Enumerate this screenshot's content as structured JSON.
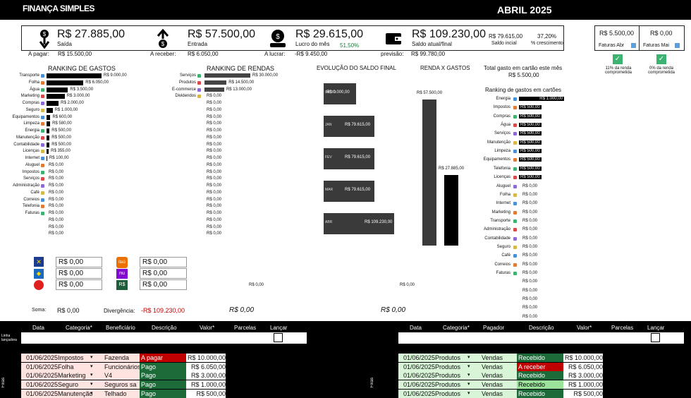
{
  "header": {
    "logo": "FINANÇA SIMPLES",
    "month": "ABRIL 2025"
  },
  "kpis": {
    "saida": {
      "value": "R$ 27.885,00",
      "label": "Saída"
    },
    "entrada": {
      "value": "R$ 57.500,00",
      "label": "Entrada"
    },
    "lucro": {
      "value": "R$ 29.615,00",
      "label": "Lucro do mês",
      "pct": "51,50%"
    },
    "saldo": {
      "value": "R$ 109.230,00",
      "label": "Saldo atual/final"
    },
    "saldo_inicial": {
      "value": "R$ 79.615,00",
      "label": "Saldo incial"
    },
    "crescimento": {
      "value": "37,20%",
      "label": "% crescimento"
    }
  },
  "subrow": {
    "a_pagar_label": "A pagar:",
    "a_pagar": "R$ 15.500,00",
    "a_receber_label": "A receber:",
    "a_receber": "R$ 6.050,00",
    "a_lucrar_label": "A lucrar:",
    "a_lucrar": "-R$ 9.450,00",
    "previsao_label": "previsão:",
    "previsao": "R$ 99.780,00"
  },
  "cards": {
    "abr": {
      "value": "R$ 5.500,00",
      "label": "Faturas Abr"
    },
    "mai": {
      "value": "R$ 0,00",
      "label": "Faturas Mai"
    },
    "pct_abr": "11% da renda comprometida",
    "pct_mai": "0% da renda comprometida"
  },
  "ranking_gastos": {
    "title": "RANKING DE GASTOS",
    "items": [
      {
        "label": "Transporte",
        "value": "R$ 9.000,00",
        "frac": 1.0
      },
      {
        "label": "Folha",
        "value": "R$ 6.050,00",
        "frac": 0.67
      },
      {
        "label": "Água",
        "value": "R$ 3.500,00",
        "frac": 0.39
      },
      {
        "label": "Marketing",
        "value": "R$ 3.000,00",
        "frac": 0.33
      },
      {
        "label": "Compras",
        "value": "R$ 2.000,00",
        "frac": 0.22
      },
      {
        "label": "Seguro",
        "value": "R$ 1.000,00",
        "frac": 0.11
      },
      {
        "label": "Equipamentos",
        "value": "R$ 600,00",
        "frac": 0.07
      },
      {
        "label": "Limpeza",
        "value": "R$ 580,00",
        "frac": 0.065
      },
      {
        "label": "Energia",
        "value": "R$ 500,00",
        "frac": 0.055
      },
      {
        "label": "Manutenção",
        "value": "R$ 500,00",
        "frac": 0.055
      },
      {
        "label": "Contabilidade",
        "value": "R$ 500,00",
        "frac": 0.055
      },
      {
        "label": "Licenças",
        "value": "R$ 355,00",
        "frac": 0.04
      },
      {
        "label": "Internet",
        "value": "R$ 100,00",
        "frac": 0.012
      },
      {
        "label": "Aluguel",
        "value": "R$ 0,00",
        "frac": 0
      },
      {
        "label": "Impostos",
        "value": "R$ 0,00",
        "frac": 0
      },
      {
        "label": "Serviços",
        "value": "R$ 0,00",
        "frac": 0
      },
      {
        "label": "Administração",
        "value": "R$ 0,00",
        "frac": 0
      },
      {
        "label": "Café",
        "value": "R$ 0,00",
        "frac": 0
      },
      {
        "label": "Correios",
        "value": "R$ 0,00",
        "frac": 0
      },
      {
        "label": "Telefonia",
        "value": "R$ 0,00",
        "frac": 0
      },
      {
        "label": "Faturas",
        "value": "R$ 0,00",
        "frac": 0
      },
      {
        "label": "",
        "value": "R$ 0,00",
        "frac": 0
      },
      {
        "label": "",
        "value": "R$ 0,00",
        "frac": 0
      },
      {
        "label": "",
        "value": "R$ 0,00",
        "frac": 0
      }
    ]
  },
  "ranking_rendas": {
    "title": "RANKING DE RENDAS",
    "items": [
      {
        "label": "Serviços",
        "value": "R$ 30.000,00",
        "frac": 1.0
      },
      {
        "label": "Produtos",
        "value": "R$ 14.500,00",
        "frac": 0.48
      },
      {
        "label": "E-commerce",
        "value": "R$ 13.000,00",
        "frac": 0.43
      },
      {
        "label": "Dividendos",
        "value": "R$ 0,00",
        "frac": 0
      },
      {
        "label": "",
        "value": "R$ 0,00",
        "frac": 0
      },
      {
        "label": "",
        "value": "R$ 0,00",
        "frac": 0
      },
      {
        "label": "",
        "value": "R$ 0,00",
        "frac": 0
      },
      {
        "label": "",
        "value": "R$ 0,00",
        "frac": 0
      },
      {
        "label": "",
        "value": "R$ 0,00",
        "frac": 0
      },
      {
        "label": "",
        "value": "R$ 0,00",
        "frac": 0
      },
      {
        "label": "",
        "value": "R$ 0,00",
        "frac": 0
      },
      {
        "label": "",
        "value": "R$ 0,00",
        "frac": 0
      },
      {
        "label": "",
        "value": "R$ 0,00",
        "frac": 0
      },
      {
        "label": "",
        "value": "R$ 0,00",
        "frac": 0
      },
      {
        "label": "",
        "value": "R$ 0,00",
        "frac": 0
      },
      {
        "label": "",
        "value": "R$ 0,00",
        "frac": 0
      },
      {
        "label": "",
        "value": "R$ 0,00",
        "frac": 0
      },
      {
        "label": "",
        "value": "R$ 0,00",
        "frac": 0
      },
      {
        "label": "",
        "value": "R$ 0,00",
        "frac": 0
      },
      {
        "label": "",
        "value": "R$ 0,00",
        "frac": 0
      },
      {
        "label": "",
        "value": "R$ 0,00",
        "frac": 0
      },
      {
        "label": "",
        "value": "R$ 0,00",
        "frac": 0
      },
      {
        "label": "",
        "value": "R$ 0,00",
        "frac": 0
      },
      {
        "label": "",
        "value": "R$ 0,00",
        "frac": 0
      }
    ]
  },
  "evolucao": {
    "title": "EVOLUÇÃO DO SALDO FINAL",
    "items": [
      {
        "label": "INÍCIO",
        "value": "R$ 0.000,00"
      },
      {
        "label": "JAN",
        "value": "R$ 79.615,00"
      },
      {
        "label": "FEV",
        "value": "R$ 79.615,00"
      },
      {
        "label": "MAR",
        "value": "R$ 79.615,00"
      },
      {
        "label": "ABR",
        "value": "R$ 109.230,00"
      }
    ],
    "footer": "R$ 0,00"
  },
  "renda_gastos": {
    "title": "RENDA X GASTOS",
    "renda": "R$ 57.500,00",
    "gastos": "R$ 27.885,00",
    "footer": "R$ 0,00"
  },
  "cartao": {
    "total_label": "Total gasto em cartão este mês",
    "total": "R$ 5.500,00",
    "ranking_title": "Ranking de gastos em cartões",
    "items": [
      {
        "label": "Energia",
        "value": "R$ 1.000,00",
        "big": true
      },
      {
        "label": "Impostos",
        "value": "R$ 500,00",
        "tag": true
      },
      {
        "label": "Compras",
        "value": "R$ 500,00",
        "tag": true
      },
      {
        "label": "Água",
        "value": "R$ 500,00",
        "tag": true
      },
      {
        "label": "Serviços",
        "value": "R$ 500,00",
        "tag": true
      },
      {
        "label": "Manutenção",
        "value": "R$ 500,00",
        "tag": true
      },
      {
        "label": "Limpeza",
        "value": "R$ 500,00",
        "tag": true
      },
      {
        "label": "Equipamentos",
        "value": "R$ 500,00",
        "tag": true
      },
      {
        "label": "Telefonia",
        "value": "R$ 500,00",
        "tag": true
      },
      {
        "label": "Licenças",
        "value": "R$ 500,00",
        "tag": true
      },
      {
        "label": "Aluguel",
        "value": "R$ 0,00"
      },
      {
        "label": "Folha",
        "value": "R$ 0,00"
      },
      {
        "label": "Internet",
        "value": "R$ 0,00"
      },
      {
        "label": "Marketing",
        "value": "R$ 0,00"
      },
      {
        "label": "Transporte",
        "value": "R$ 0,00"
      },
      {
        "label": "Administração",
        "value": "R$ 0,00"
      },
      {
        "label": "Contabilidade",
        "value": "R$ 0,00"
      },
      {
        "label": "Seguro",
        "value": "R$ 0,00"
      },
      {
        "label": "Café",
        "value": "R$ 0,00"
      },
      {
        "label": "Correios",
        "value": "R$ 0,00"
      },
      {
        "label": "Faturas",
        "value": "R$ 0,00"
      },
      {
        "label": "",
        "value": "R$ 0,00"
      },
      {
        "label": "",
        "value": "R$ 0,00"
      },
      {
        "label": "",
        "value": "R$ 0,00"
      },
      {
        "label": "",
        "value": "R$ 0,00"
      },
      {
        "label": "",
        "value": "R$ 0,00"
      }
    ]
  },
  "banks": {
    "left": [
      "R$ 0,00",
      "R$ 0,00",
      "R$ 0,00"
    ],
    "right": [
      "R$ 0,00",
      "R$ 0,00",
      "R$ 0,00"
    ],
    "itau": "itaú",
    "nu": "nu",
    "rs": "R$"
  },
  "footer": {
    "soma_label": "Soma:",
    "soma": "R$ 0,00",
    "div_label": "Divergência:",
    "div": "-R$ 109.230,00",
    "rendas_total": "R$ 0,00"
  },
  "gastos_table": {
    "headers": [
      "Data",
      "Categoria*",
      "Beneficiário",
      "Descrição",
      "Valor*",
      "Parcelas",
      "Lançar"
    ],
    "linha_label": "Linha lançadora",
    "fixas_label": "Fixas",
    "rows": [
      {
        "date": "01/06/2025",
        "cat": "Impostos",
        "ben": "Fazenda",
        "status": "A pagar",
        "st": "red",
        "val": "R$ 10.000,00"
      },
      {
        "date": "01/06/2025",
        "cat": "Folha",
        "ben": "Funcionários",
        "status": "Pago",
        "st": "green",
        "val": "R$ 6.050,00"
      },
      {
        "date": "01/06/2025",
        "cat": "Marketing",
        "ben": "V4",
        "status": "Pago",
        "st": "green",
        "val": "R$ 3.000,00"
      },
      {
        "date": "01/06/2025",
        "cat": "Seguro",
        "ben": "Seguros sa",
        "status": "Pago",
        "st": "green",
        "val": "R$ 1.000,00"
      },
      {
        "date": "01/06/2025",
        "cat": "Manutenção",
        "ben": "Telhado",
        "status": "Pago",
        "st": "green",
        "val": "R$ 500,00"
      }
    ]
  },
  "rendas_table": {
    "headers": [
      "Data",
      "Categoria*",
      "Pagador",
      "Descrição",
      "Valor*",
      "Parcelas",
      "Lançar"
    ],
    "fixas_label": "Fixas",
    "rows": [
      {
        "date": "01/06/2025",
        "cat": "Produtos",
        "ben": "Vendas",
        "status": "Recebido",
        "st": "green",
        "val": "R$ 10.000,00"
      },
      {
        "date": "01/06/2025",
        "cat": "Produtos",
        "ben": "Vendas",
        "status": "A receber",
        "st": "red",
        "val": "R$ 6.050,00"
      },
      {
        "date": "01/06/2025",
        "cat": "Produtos",
        "ben": "Vendas",
        "status": "Recebido",
        "st": "green",
        "val": "R$ 3.000,00"
      },
      {
        "date": "01/06/2025",
        "cat": "Produtos",
        "ben": "Vendas",
        "status": "Recebido",
        "st": "green",
        "val": "R$ 1.000,00"
      },
      {
        "date": "01/06/2025",
        "cat": "Produtos",
        "ben": "Vendas",
        "status": "Recebido",
        "st": "green",
        "val": "R$ 500,00"
      }
    ]
  },
  "colors": {
    "accent": "#1f7a3d",
    "negative": "#c00000",
    "bar": "#000000",
    "bar_dark": "#3a3a3a"
  }
}
